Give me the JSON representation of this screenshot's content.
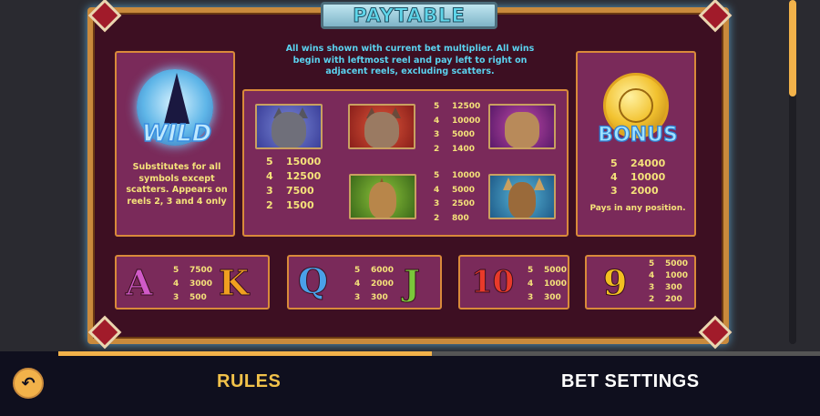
{
  "title": "PAYTABLE",
  "intro": "All wins shown with current bet multiplier. All wins begin with leftmost reel and pay left to right on adjacent reels, excluding scatters.",
  "wild": {
    "label": "WILD",
    "description": "Substitutes for all symbols except scatters. Appears on reels 2, 3 and 4 only",
    "icon": "wolf-moon-icon"
  },
  "bonus": {
    "label": "BONUS",
    "icon": "gold-wolf-coin-icon",
    "pays": [
      {
        "count": "5",
        "value": "24000"
      },
      {
        "count": "4",
        "value": "10000"
      },
      {
        "count": "3",
        "value": "2000"
      }
    ],
    "note": "Pays in any position."
  },
  "high_symbols": {
    "icons": [
      "wolf-icon",
      "lynx-icon",
      "owl-icon",
      "hare-icon",
      "deer-icon"
    ],
    "wolf_pays": [
      {
        "count": "5",
        "value": "15000"
      },
      {
        "count": "4",
        "value": "12500"
      },
      {
        "count": "3",
        "value": "7500"
      },
      {
        "count": "2",
        "value": "1500"
      }
    ],
    "lynx_owl_pays": [
      {
        "count": "5",
        "value": "12500"
      },
      {
        "count": "4",
        "value": "10000"
      },
      {
        "count": "3",
        "value": "5000"
      },
      {
        "count": "2",
        "value": "1400"
      }
    ],
    "hare_deer_pays": [
      {
        "count": "5",
        "value": "10000"
      },
      {
        "count": "4",
        "value": "5000"
      },
      {
        "count": "3",
        "value": "2500"
      },
      {
        "count": "2",
        "value": "800"
      }
    ]
  },
  "low_symbols": [
    {
      "symbols": [
        "A",
        "K"
      ],
      "pays": [
        {
          "count": "5",
          "value": "7500"
        },
        {
          "count": "4",
          "value": "3000"
        },
        {
          "count": "3",
          "value": "500"
        }
      ]
    },
    {
      "symbols": [
        "Q",
        "J"
      ],
      "pays": [
        {
          "count": "5",
          "value": "6000"
        },
        {
          "count": "4",
          "value": "2000"
        },
        {
          "count": "3",
          "value": "300"
        }
      ]
    },
    {
      "symbols": [
        "10"
      ],
      "pays": [
        {
          "count": "5",
          "value": "5000"
        },
        {
          "count": "4",
          "value": "1000"
        },
        {
          "count": "3",
          "value": "300"
        }
      ]
    },
    {
      "symbols": [
        "9"
      ],
      "pays": [
        {
          "count": "5",
          "value": "5000"
        },
        {
          "count": "4",
          "value": "1000"
        },
        {
          "count": "3",
          "value": "300"
        },
        {
          "count": "2",
          "value": "200"
        }
      ]
    }
  ],
  "nav": {
    "back_icon": "back-arrow-icon",
    "rules_label": "RULES",
    "bet_settings_label": "BET SETTINGS",
    "page_progress": 0.49,
    "scroll_position": 0.0
  },
  "colors": {
    "frame": "#c98a3c",
    "panel": "#7a2a5a",
    "pay_text": "#f5e27a",
    "intro_text": "#5ad2ef",
    "accent": "#f2b24a"
  }
}
